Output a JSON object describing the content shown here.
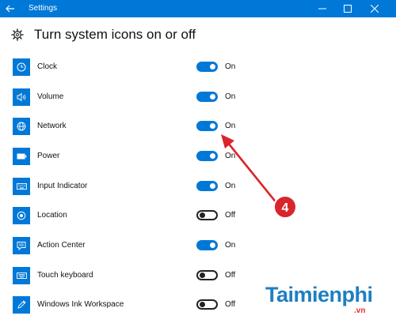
{
  "window": {
    "title": "Settings"
  },
  "page": {
    "title": "Turn system icons on or off"
  },
  "items": [
    {
      "label": "Clock",
      "state": "On",
      "on": true,
      "icon": "clock-icon"
    },
    {
      "label": "Volume",
      "state": "On",
      "on": true,
      "icon": "volume-icon"
    },
    {
      "label": "Network",
      "state": "On",
      "on": true,
      "icon": "network-globe-icon"
    },
    {
      "label": "Power",
      "state": "On",
      "on": true,
      "icon": "battery-icon"
    },
    {
      "label": "Input Indicator",
      "state": "On",
      "on": true,
      "icon": "keyboard-icon"
    },
    {
      "label": "Location",
      "state": "Off",
      "on": false,
      "icon": "location-icon"
    },
    {
      "label": "Action Center",
      "state": "On",
      "on": true,
      "icon": "action-center-icon"
    },
    {
      "label": "Touch keyboard",
      "state": "Off",
      "on": false,
      "icon": "touch-keyboard-icon"
    },
    {
      "label": "Windows Ink Workspace",
      "state": "Off",
      "on": false,
      "icon": "pen-icon"
    }
  ],
  "annotation": {
    "number": "4"
  },
  "watermark": {
    "brand": "Taimienphi",
    "domain": ".vn"
  },
  "colors": {
    "accent": "#0078d7",
    "annotation": "#d9252c",
    "watermark_blue": "#1e7fc1",
    "watermark_red": "#e0302b"
  }
}
